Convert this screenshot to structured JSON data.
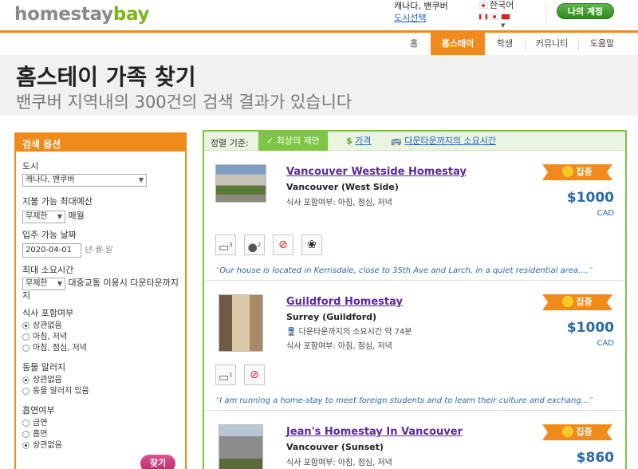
{
  "header": {
    "logo_part1": "homestay",
    "logo_part2": "bay",
    "city": "캐나다, 밴쿠버",
    "city_select": "도시선택",
    "language": "한국어",
    "account_button": "나의 계정"
  },
  "nav": {
    "items": [
      "홈",
      "홈스테이",
      "학생",
      "커뮤니티",
      "도움말"
    ],
    "active_index": 1
  },
  "title": {
    "main": "홈스테이 가족 찾기",
    "sub": "밴쿠버 지역내의 300건의 검색 결과가 있습니다"
  },
  "sidebar": {
    "heading": "검색 옵션",
    "city_label": "도시",
    "city_value": "캐나다, 밴쿠버",
    "budget_label": "지불 가능 최대예산",
    "budget_value": "무제한",
    "budget_unit": "매월",
    "movein_label": "입주 가능 날짜",
    "movein_value": "2020-04-01",
    "movein_hint": "년-월-일",
    "commute_label": "최대 소요시간",
    "commute_value": "무제한",
    "commute_text": "대중교통 이용시 다운타운까지",
    "meals_label": "식사 포함여부",
    "meals_options": [
      "상관없음",
      "아침, 저녁",
      "아침, 점심, 저녁"
    ],
    "meals_selected": 0,
    "pets_label": "동물 알러지",
    "pets_options": [
      "상관없음",
      "동물 알러지 있음"
    ],
    "pets_selected": 0,
    "smoking_label": "흡연여부",
    "smoking_options": [
      "금연",
      "흡연",
      "상관없음"
    ],
    "smoking_selected": 2,
    "search_button": "찾기"
  },
  "sortbar": {
    "label": "정렬 기준:",
    "best": "최상의 제안",
    "price": "가격",
    "commute": "다운타운까지의 소요시간"
  },
  "listings": [
    {
      "title": "Vancouver Westside Homestay",
      "area": "Vancouver (West Side)",
      "meals": "식사 포함여부: 아침, 점심, 저녁",
      "commute": "",
      "badge": "집중",
      "price": "$1000",
      "currency": "CAD",
      "amenity_counts": [
        "3",
        "2"
      ],
      "quote": "Our house is located in Kerrisdale, close to 35th Ave and Larch, in a quiet residential area...."
    },
    {
      "title": "Guildford Homestay",
      "area": "Surrey (Guildford)",
      "meals": "식사 포함여부: 아침, 점심, 저녁",
      "commute": "다운타운까지의 소요시간 약 74분",
      "badge": "집중",
      "price": "$1000",
      "currency": "CAD",
      "amenity_counts": [
        "1"
      ],
      "quote": "I am running a home-stay to meet foreign students and to learn their culture and exchang..."
    },
    {
      "title": "Jean's Homestay In Vancouver",
      "area": "Vancouver (Sunset)",
      "meals": "식사 포함여부: 아침, 점심, 저녁",
      "commute": "",
      "badge": "집중",
      "price": "$860",
      "currency": "",
      "amenity_counts": [],
      "quote": ""
    }
  ],
  "colors": {
    "orange": "#f08a1a",
    "green": "#7dc542",
    "link_blue": "#2060c0",
    "price_blue": "#2a6aa8"
  }
}
